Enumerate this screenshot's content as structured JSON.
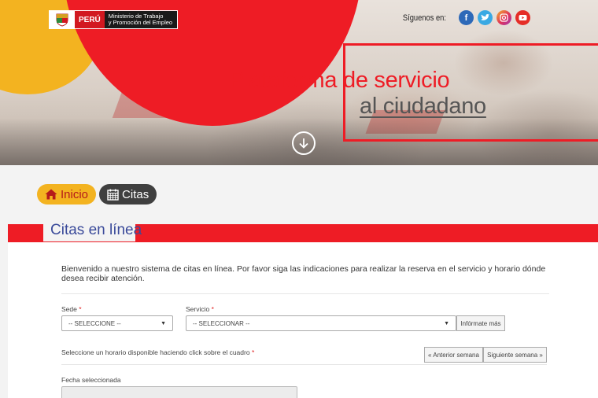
{
  "header": {
    "logo_peru": "PERÚ",
    "logo_ministry_line1": "Ministerio de Trabajo",
    "logo_ministry_line2": "y Promoción del Empleo",
    "social_label": "Síguenos en:",
    "social_icons": [
      "facebook-icon",
      "twitter-icon",
      "instagram-icon",
      "youtube-icon"
    ],
    "title_line1": "Plataforma de servicio",
    "title_line2": "al ciudadano"
  },
  "breadcrumb": {
    "home_label": "Inicio",
    "current_label": "Citas"
  },
  "section": {
    "title": "Citas en línea"
  },
  "form": {
    "intro": "Bienvenido a nuestro sistema de citas en línea. Por favor siga las indicaciones para realizar la reserva en el servicio y horario dónde desea recibir atención.",
    "sede_label": "Sede",
    "sede_value": "-- SELECCIONE --",
    "servicio_label": "Servicio",
    "servicio_value": "-- SELECCIONAR --",
    "info_button": "Infórmate más",
    "schedule_label": "Seleccione un horario disponible haciendo click sobre el cuadro",
    "prev_week": "« Anterior semana",
    "next_week": "Siguiente semana »",
    "date_label": "Fecha seleccionada",
    "required_mark": "*"
  },
  "colors": {
    "brand_red": "#ee1c25",
    "brand_yellow": "#f3b320",
    "dark_pill": "#3f3f3f",
    "title_blue": "#3a4a9a"
  }
}
